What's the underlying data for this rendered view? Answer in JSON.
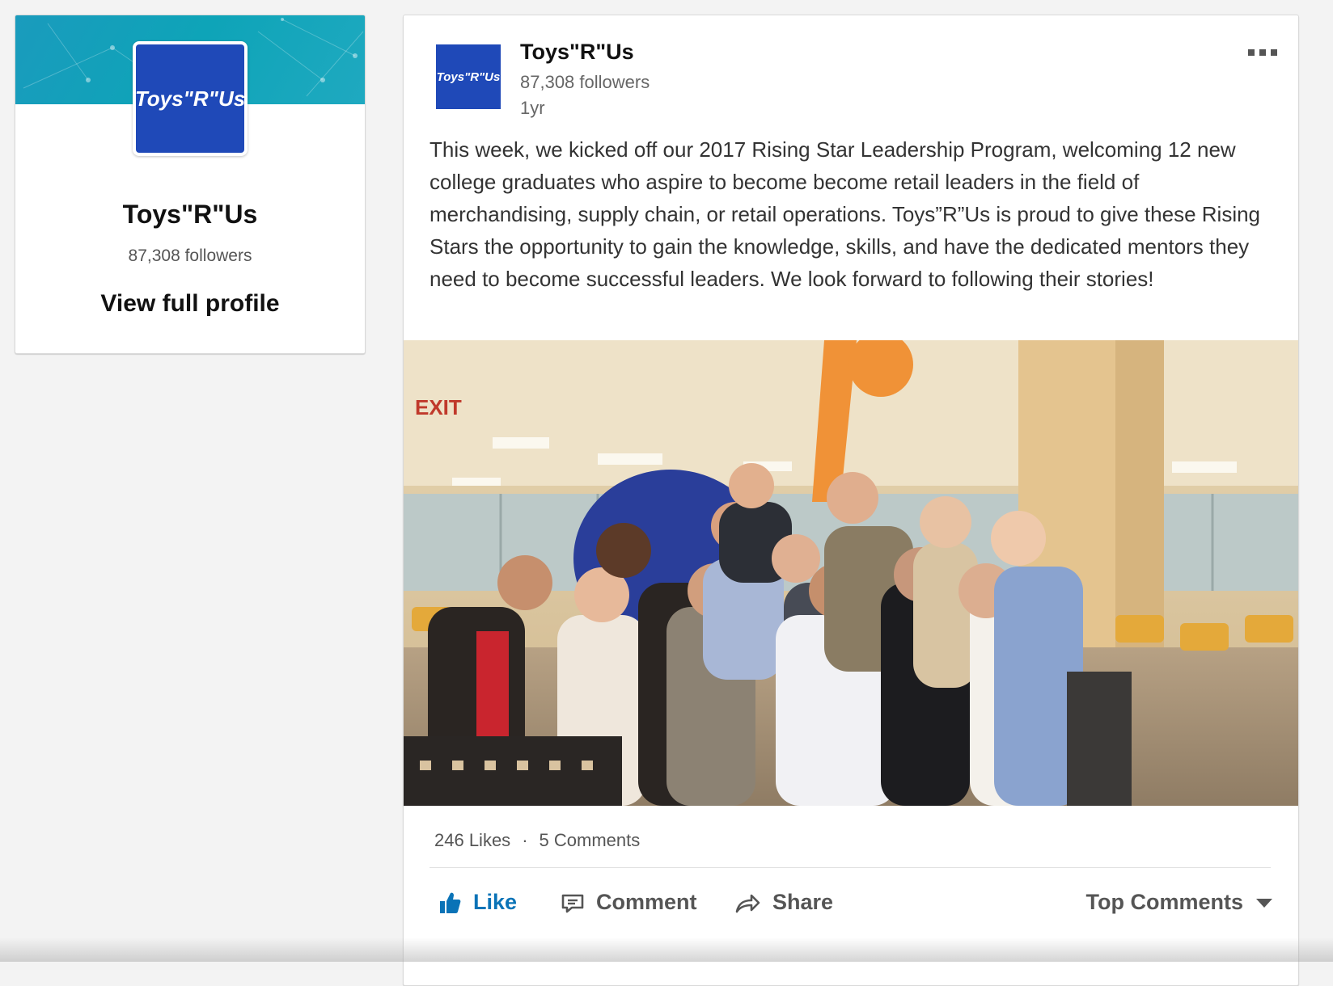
{
  "profile": {
    "logo_text": "Toys\"R\"Us",
    "name": "Toys\"R\"Us",
    "followers": "87,308 followers",
    "link": "View full profile"
  },
  "post": {
    "author": "Toys\"R\"Us",
    "followers": "87,308 followers",
    "time": "1yr",
    "avatar_text": "Toys\"R\"Us",
    "text": "This week, we kicked off our 2017 Rising Star Leadership Program, welcoming 12 new college graduates who aspire to become become retail leaders in the field of merchandising, supply chain, or retail operations. Toys”R”Us is proud to give these Rising Stars the opportunity to gain the knowledge, skills, and have the dedicated mentors they need to become successful leaders. We look forward to following their stories!",
    "image_sign": "EXIT",
    "likes": "246 Likes",
    "separator": "·",
    "comments": "5 Comments"
  },
  "actions": {
    "like": "Like",
    "comment": "Comment",
    "share": "Share",
    "sort": "Top Comments"
  },
  "colors": {
    "brand_blue": "#1f49b8",
    "link_blue": "#0a73b7",
    "banner_teal": "#1a9bbd"
  }
}
